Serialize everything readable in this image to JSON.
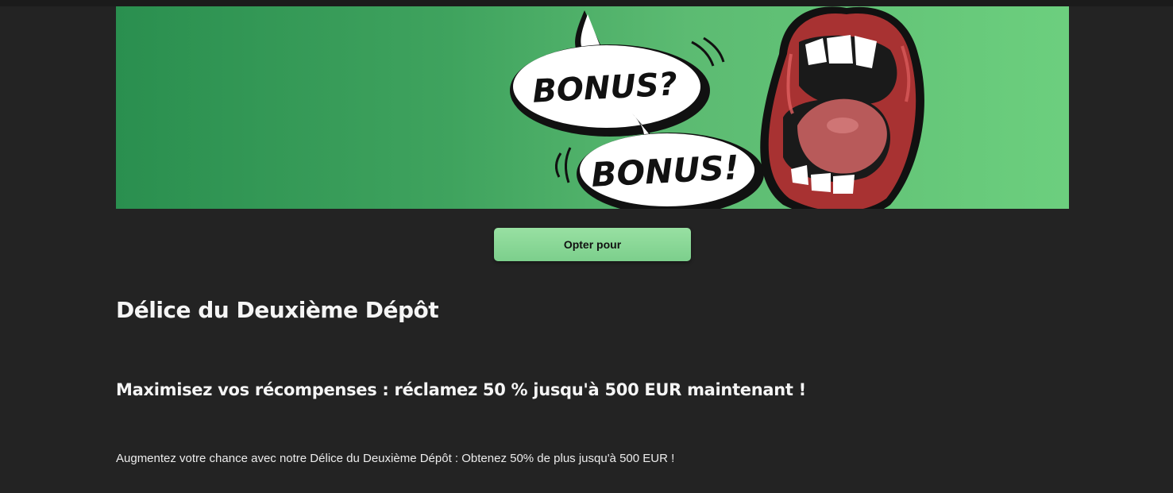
{
  "banner": {
    "bubble_top_text": "BONUS?",
    "bubble_bottom_text": "BONUS!",
    "colors": {
      "green_dark": "#2a8f4f",
      "green_light": "#6ccf7e",
      "lips": "#a83232",
      "tongue": "#b85a5a"
    }
  },
  "cta": {
    "label": "Opter pour",
    "color": "#8fd99c"
  },
  "content": {
    "title": "Délice du Deuxième Dépôt",
    "subtitle": "Maximisez vos récompenses : réclamez 50 % jusqu'à 500 EUR maintenant !",
    "description": "Augmentez votre chance avec notre Délice du Deuxième Dépôt : Obtenez 50% de plus jusqu'à 500 EUR !"
  }
}
